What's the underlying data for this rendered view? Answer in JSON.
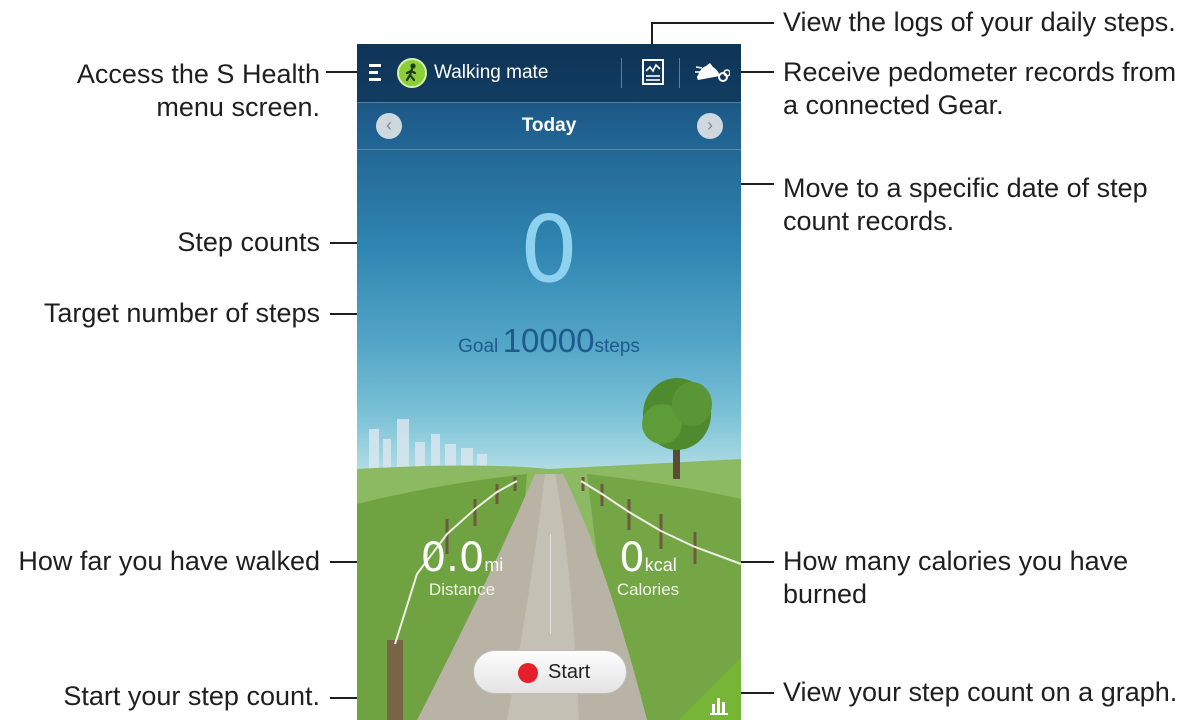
{
  "app": {
    "title": "Walking mate",
    "date_label": "Today",
    "step_count": "0",
    "goal_prefix": "Goal",
    "goal_value": "10000",
    "goal_suffix": "steps",
    "distance_value": "0.0",
    "distance_unit": "mi",
    "distance_label": "Distance",
    "calories_value": "0",
    "calories_unit": "kcal",
    "calories_label": "Calories",
    "start_label": "Start"
  },
  "annotations": {
    "menu": [
      "Access the S Health",
      "menu screen."
    ],
    "logs": "View the logs of your daily steps.",
    "gear": [
      "Receive pedometer records from",
      "a connected Gear."
    ],
    "date": [
      "Move to a specific date of step",
      "count records."
    ],
    "steps": "Step counts",
    "target": "Target number of steps",
    "distance": "How far you have walked",
    "calories": [
      "How many calories you have",
      "burned"
    ],
    "start": "Start your step count.",
    "graph": "View your step count on a graph."
  },
  "icons": {
    "menu": "menu-icon",
    "walker": "walker-icon",
    "log": "log-icon",
    "shoe": "shoe-gear-icon",
    "prev": "chevron-left-icon",
    "next": "chevron-right-icon",
    "record": "record-dot-icon",
    "graph": "bar-chart-icon"
  },
  "colors": {
    "accent_green": "#8ccd3a",
    "step_count": "#8ed2ef",
    "goal_text": "#1e5a8a",
    "record_red": "#e5202a",
    "graph_green": "#76b535"
  }
}
